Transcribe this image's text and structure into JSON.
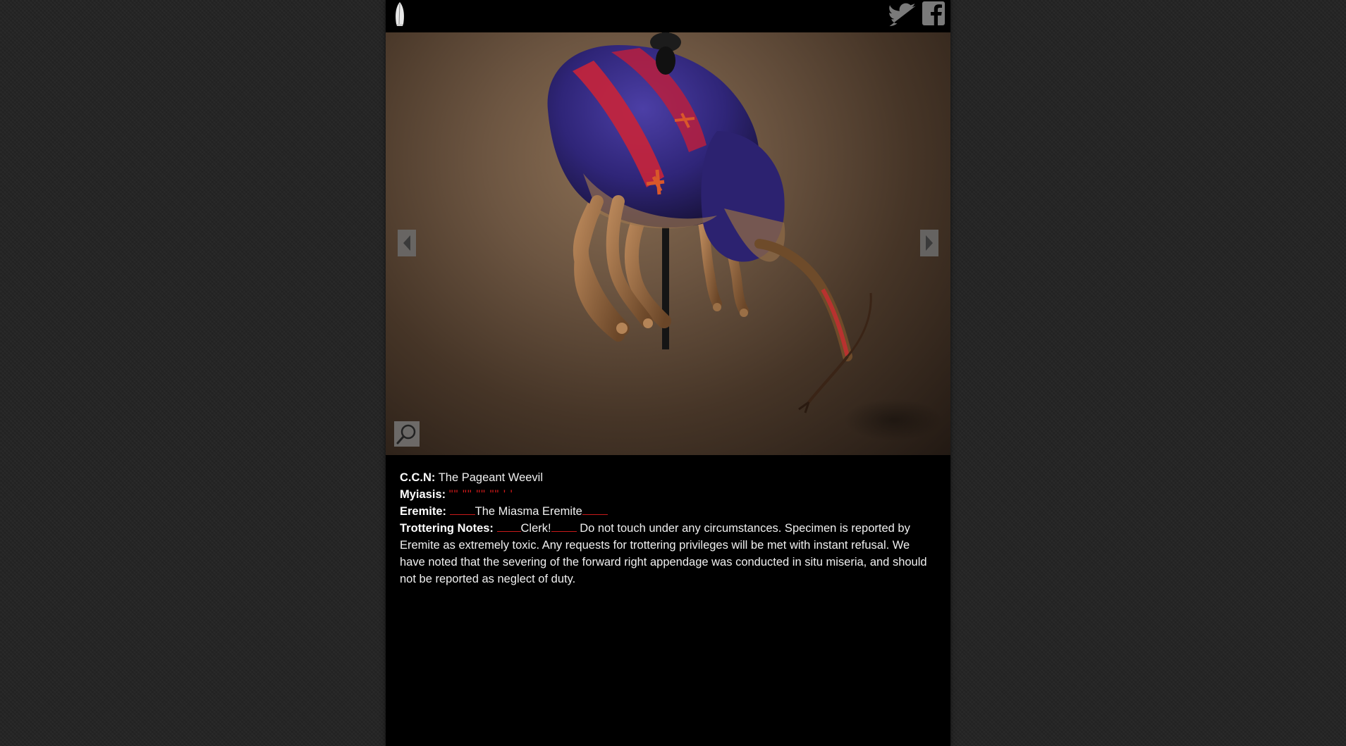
{
  "header": {
    "logo_icon": "quill-logo-icon",
    "twitter_icon": "twitter-icon",
    "facebook_icon": "facebook-icon"
  },
  "gallery": {
    "prev_icon": "left-arrow-icon",
    "next_icon": "right-arrow-icon",
    "zoom_icon": "magnifier-icon"
  },
  "specimen": {
    "ccn_label": "C.C.N:",
    "ccn_value": "The Pageant Weevil",
    "myiasis_label": "Myiasis:",
    "myiasis_value": "\"\" \"\" \"\" \"\" ' '",
    "eremite_label": "Eremite:",
    "eremite_value": "The Miasma Eremite",
    "notes_label": "Trottering Notes:",
    "notes_prefix": "Clerk!",
    "notes_text": "Do not touch under any circumstances. Specimen is reported by Eremite as extremely toxic. Any requests for trottering privileges will be met with instant refusal. We have noted that the severing of the forward right appendage was conducted in situ miseria, and should not be reported as neglect of duty."
  },
  "colors": {
    "page_background": "#232323",
    "panel_background": "#000000",
    "text": "#f0f0f0",
    "redaction": "#d11a1a"
  }
}
